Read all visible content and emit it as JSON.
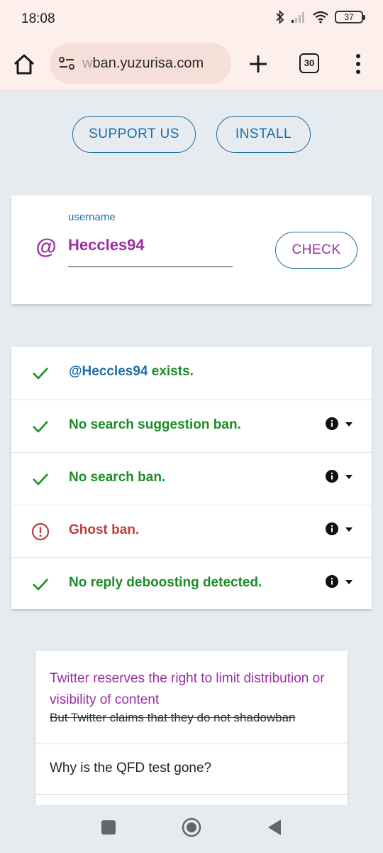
{
  "status_bar": {
    "time": "18:08",
    "battery": "37"
  },
  "browser": {
    "url_prefix": "w",
    "url_domain": "ban.yuzurisa.com",
    "tab_count": "30"
  },
  "buttons": {
    "support": "SUPPORT US",
    "install": "INSTALL",
    "check": "CHECK"
  },
  "form": {
    "at": "@",
    "label": "username",
    "value": "Heccles94"
  },
  "results": [
    {
      "status": "ok",
      "prefix": "@Heccles94",
      "text": " exists.",
      "has_info": false
    },
    {
      "status": "ok",
      "prefix": "",
      "text": "No search suggestion ban.",
      "has_info": true
    },
    {
      "status": "ok",
      "prefix": "",
      "text": "No search ban.",
      "has_info": true
    },
    {
      "status": "bad",
      "prefix": "",
      "text": "Ghost ban.",
      "has_info": true
    },
    {
      "status": "ok",
      "prefix": "",
      "text": "No reply deboosting detected.",
      "has_info": true
    }
  ],
  "faq": {
    "headline": "Twitter reserves the right to limit distribution or visibility of content",
    "strike": "But Twitter claims that they do not shadowban",
    "question": "Why is the QFD test gone?"
  },
  "colors": {
    "accent_blue": "#1c6ea4",
    "accent_purple": "#9c2ea4",
    "ok_green": "#1b8d24",
    "error_red": "#c23b3b"
  }
}
